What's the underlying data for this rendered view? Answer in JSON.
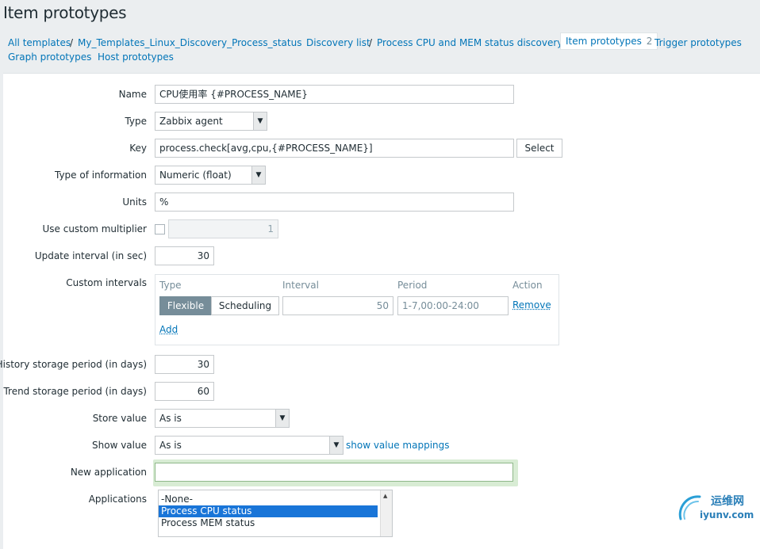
{
  "page": {
    "title": "Item prototypes"
  },
  "breadcrumbs": {
    "all_templates": "All templates",
    "sep1": "/",
    "template": "My_Templates_Linux_Discovery_Process_status",
    "discovery_list": "Discovery list",
    "sep2": "/",
    "discovery_rule": "Process CPU and MEM status discovery",
    "item_prototypes": "Item prototypes",
    "item_prototypes_count": "2",
    "trigger_prototypes": "Trigger prototypes",
    "graph_prototypes": "Graph prototypes",
    "host_prototypes": "Host prototypes"
  },
  "form": {
    "name_label": "Name",
    "name_value": "CPU使用率 {#PROCESS_NAME}",
    "type_label": "Type",
    "type_value": "Zabbix agent",
    "key_label": "Key",
    "key_value": "process.check[avg,cpu,{#PROCESS_NAME}]",
    "select_button": "Select",
    "info_label": "Type of information",
    "info_value": "Numeric (float)",
    "units_label": "Units",
    "units_value": "%",
    "multiplier_label": "Use custom multiplier",
    "multiplier_value": "1",
    "interval_label": "Update interval (in sec)",
    "interval_value": "30",
    "custom_label": "Custom intervals",
    "custom": {
      "col_type": "Type",
      "col_interval": "Interval",
      "col_period": "Period",
      "col_action": "Action",
      "flexible": "Flexible",
      "scheduling": "Scheduling",
      "interval_value": "50",
      "period_value": "1-7,00:00-24:00",
      "remove": "Remove",
      "add": "Add"
    },
    "history_label": "History storage period (in days)",
    "history_value": "30",
    "trend_label": "Trend storage period (in days)",
    "trend_value": "60",
    "store_label": "Store value",
    "store_value": "As is",
    "show_label": "Show value",
    "show_value": "As is",
    "show_mappings": "show value mappings",
    "newapp_label": "New application",
    "newapp_value": "",
    "apps_label": "Applications",
    "apps": [
      "-None-",
      "Process CPU status",
      "Process MEM status"
    ]
  },
  "watermark": {
    "text_cn": "运维网",
    "text_url": "iyunv.com"
  },
  "colors": {
    "link": "#0275b8",
    "selected": "#1975d8",
    "focus": "#d8ecd4",
    "segment_active": "#768d99"
  }
}
